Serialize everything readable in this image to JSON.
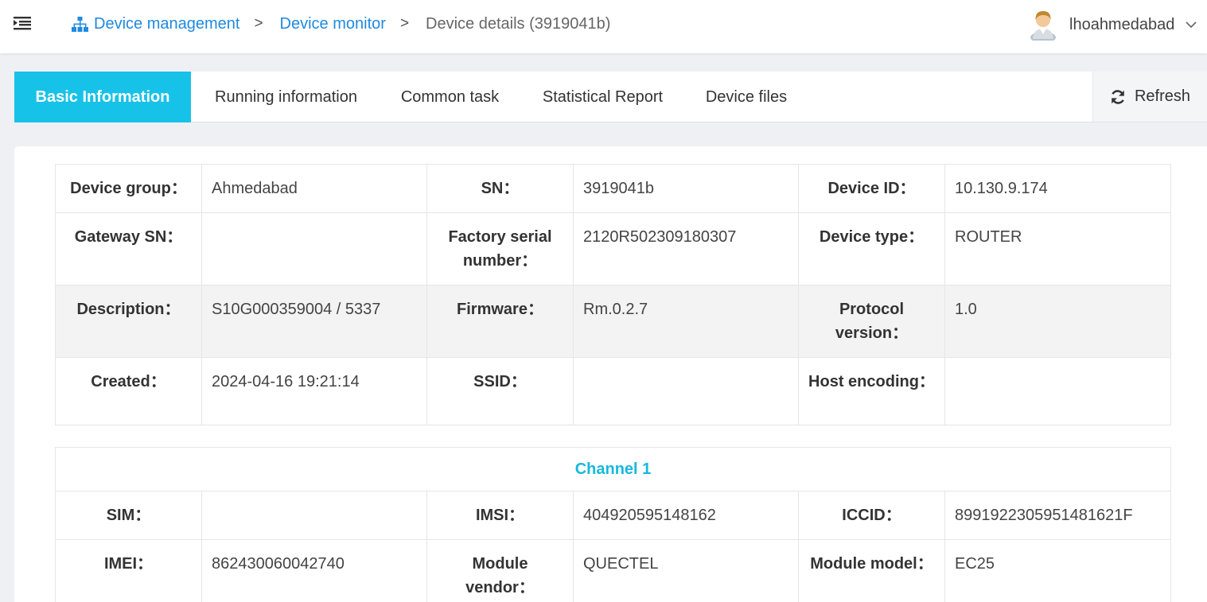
{
  "header": {
    "breadcrumb": [
      {
        "label": "Device management",
        "icon": "sitemap-icon"
      },
      {
        "label": "Device monitor"
      },
      {
        "label": "Device details (3919041b)"
      }
    ],
    "separator": ">",
    "user": {
      "name": "lhoahmedabad"
    }
  },
  "tabs": [
    {
      "label": "Basic Information",
      "active": true
    },
    {
      "label": "Running information",
      "active": false
    },
    {
      "label": "Common task",
      "active": false
    },
    {
      "label": "Statistical Report",
      "active": false
    },
    {
      "label": "Device files",
      "active": false
    }
  ],
  "refresh_label": "Refresh",
  "basic_info": [
    [
      {
        "label": "Device group：",
        "value": "Ahmedabad"
      },
      {
        "label": "SN：",
        "value": "3919041b"
      },
      {
        "label": "Device ID：",
        "value": "10.130.9.174"
      }
    ],
    [
      {
        "label": "Gateway SN：",
        "value": ""
      },
      {
        "label": "Factory serial number：",
        "value": "2120R502309180307"
      },
      {
        "label": "Device type：",
        "value": "ROUTER"
      }
    ],
    [
      {
        "label": "Description：",
        "value": "S10G000359004 / 5337"
      },
      {
        "label": "Firmware：",
        "value": "Rm.0.2.7"
      },
      {
        "label": "Protocol version：",
        "value": "1.0"
      }
    ],
    [
      {
        "label": "Created：",
        "value": "2024-04-16 19:21:14"
      },
      {
        "label": "SSID：",
        "value": ""
      },
      {
        "label": "Host encoding：",
        "value": ""
      }
    ]
  ],
  "channel": {
    "title": "Channel 1",
    "rows": [
      [
        {
          "label": "SIM：",
          "value": ""
        },
        {
          "label": "IMSI：",
          "value": "404920595148162"
        },
        {
          "label": "ICCID：",
          "value": "8991922305951481621F"
        }
      ],
      [
        {
          "label": "IMEI：",
          "value": "862430060042740"
        },
        {
          "label": "Module vendor：",
          "value": "QUECTEL"
        },
        {
          "label": "Module model：",
          "value": "EC25"
        }
      ]
    ]
  },
  "colors": {
    "accent": "#17c2e8",
    "link": "#1f8ae0",
    "channel_title": "#17b8de"
  }
}
